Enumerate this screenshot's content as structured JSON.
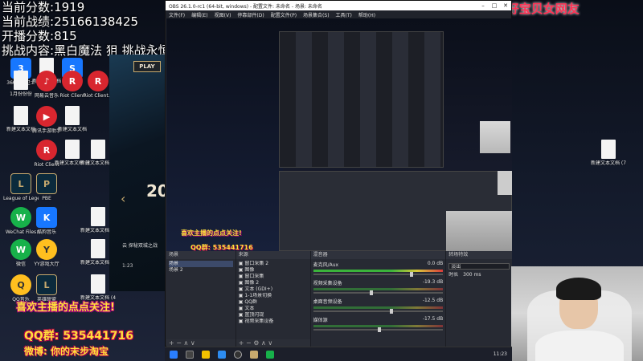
{
  "stats": {
    "current_score_label": "当前分数:",
    "current_score": "1919",
    "current_flow_label": "当前战绩:",
    "current_flow": "25166138425",
    "start_score_label": "开播分数:",
    "start_score": "815",
    "challenge_label": "挑战内容:",
    "challenge_text": "黑白魔法 狙 挑战永恒之恶复活亡灵"
  },
  "banner_top": "上周的神: 宇宙无敌好宝贝女网友",
  "desktop_icons": [
    {
      "label": "360安全卫士",
      "style": "blue",
      "glyph": "3"
    },
    {
      "label": "新建文本文档",
      "style": "doc",
      "glyph": ""
    },
    {
      "label": "Steam",
      "style": "blue",
      "glyph": "S"
    },
    {
      "label": "1月份份份",
      "style": "doc",
      "glyph": ""
    },
    {
      "label": "网易云音乐",
      "style": "red",
      "glyph": "♪"
    },
    {
      "label": "Riot Client",
      "style": "red",
      "glyph": "R"
    },
    {
      "label": "Riot Client...",
      "style": "red",
      "glyph": "R"
    },
    {
      "label": "新建文本文档",
      "style": "doc",
      "glyph": ""
    },
    {
      "label": "腾讯手游助手",
      "style": "red",
      "glyph": "▶"
    },
    {
      "label": "新建文本文档",
      "style": "doc",
      "glyph": ""
    },
    {
      "label": "Riot Client",
      "style": "red",
      "glyph": "R"
    },
    {
      "label": "新建文本文档 (14)",
      "style": "doc",
      "glyph": ""
    },
    {
      "label": "新建文本文档 (15)",
      "style": "doc",
      "glyph": ""
    },
    {
      "label": "League of Legends",
      "style": "lol",
      "glyph": "L"
    },
    {
      "label": "PBE",
      "style": "lol",
      "glyph": "P"
    },
    {
      "label": "WeChat Files",
      "style": "green",
      "glyph": "W"
    },
    {
      "label": "酷狗音乐",
      "style": "blue",
      "glyph": "K"
    },
    {
      "label": "新建文本文档 (12)",
      "style": "doc",
      "glyph": ""
    },
    {
      "label": "微信",
      "style": "green",
      "glyph": "W"
    },
    {
      "label": "YY游戏大厅",
      "style": "yellow",
      "glyph": "Y"
    },
    {
      "label": "新建文本文档 (9)",
      "style": "doc",
      "glyph": ""
    },
    {
      "label": "新建文本文档 (7)",
      "style": "doc",
      "glyph": ""
    },
    {
      "label": "QQ音乐",
      "style": "yellow",
      "glyph": "Q"
    },
    {
      "label": "英雄联盟",
      "style": "lol",
      "glyph": "L"
    },
    {
      "label": "新建文本文档 (4)",
      "style": "doc",
      "glyph": ""
    }
  ],
  "lol_client": {
    "play": "PLAY",
    "big": "20",
    "arrow": "‹",
    "footer_line1": "云 探秘双城之战",
    "footer_line2": "1:23"
  },
  "obs": {
    "title": "OBS 26.1.0-rc1 (64-bit, windows) - 配置文件: 未命名 - 场景: 未命名",
    "menu": [
      "文件(F)",
      "编辑(E)",
      "视图(V)",
      "停靠部件(D)",
      "配置文件(P)",
      "场景集合(S)",
      "工具(T)",
      "帮助(H)"
    ],
    "docks": {
      "scenes": {
        "title": "场景",
        "items": [
          "场景",
          "场景 2"
        ],
        "footer": "+ −  ∧ ∨"
      },
      "sources": {
        "title": "来源",
        "items": [
          "窗口采集 2",
          "图像",
          "窗口采集",
          "图像 2",
          "文本 (GDI+)",
          "1-1场景切换",
          "QQ群",
          "文本",
          "置顶闪现",
          "视频采集设备"
        ],
        "footer": "+ − ⚙ ∧ ∨"
      },
      "mixer": {
        "title": "混音器",
        "channels": [
          {
            "name": "麦克风/Aux",
            "db": "0.0 dB"
          },
          {
            "name": "视频采集设备",
            "db": "-19.3 dB"
          },
          {
            "name": "桌面音频设备",
            "db": "-12.5 dB"
          },
          {
            "name": "媒体源",
            "db": "-17.5 dB"
          }
        ]
      },
      "transitions": {
        "title": "转场特效",
        "type": "淡出",
        "duration_label": "时长",
        "duration": "300 ms"
      }
    }
  },
  "overlays": {
    "follow": "喜欢主播的点点关注!",
    "qq": "QQ群: 535441716",
    "weibo": "微博: 你的末步淘宝",
    "top_follow": "喜欢主播的点点关注!",
    "top_qq": "QQ群: 535441716"
  },
  "taskbar": {
    "clock": "11:23"
  }
}
